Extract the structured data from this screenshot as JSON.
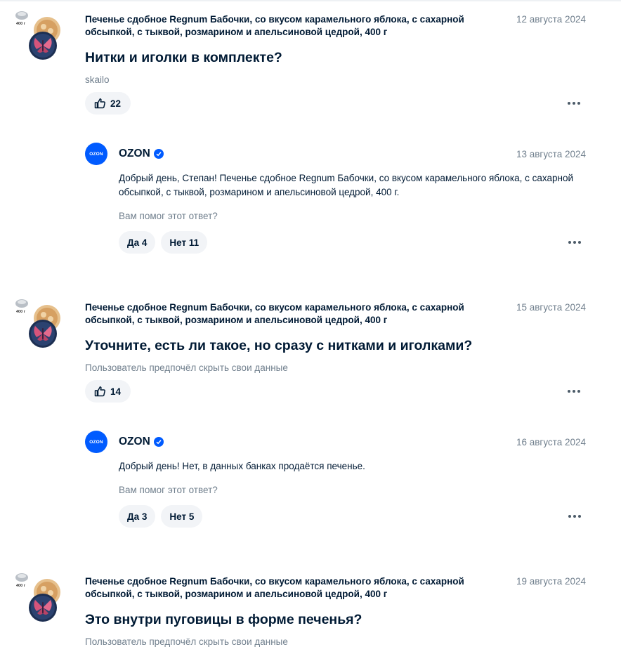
{
  "colors": {
    "accent": "#005bff",
    "text": "#001a34",
    "muted": "#707f8d",
    "chip": "#f2f4f7"
  },
  "questions": [
    {
      "product": "Печенье сдобное Regnum Бабочки, со вкусом карамельного яблока, с сахарной обсыпкой, с тыквой, розмарином и апельсиновой цедрой, 400 г",
      "date": "12 августа 2024",
      "question": "Нитки и иголки в комплекте?",
      "author": "skailo",
      "likes": "22",
      "answer": {
        "logo_text": "OZON",
        "seller": "OZON",
        "date": "13 августа 2024",
        "text": "Добрый день, Степан! Печенье сдобное Regnum Бабочки, со вкусом карамельного яблока, с сахарной обсыпкой, с тыквой, розмарином и апельсиновой цедрой, 400 г.",
        "helpful_prompt": "Вам помог этот ответ?",
        "yes_label": "Да 4",
        "no_label": "Нет 11"
      }
    },
    {
      "product": "Печенье сдобное Regnum Бабочки, со вкусом карамельного яблока, с сахарной обсыпкой, с тыквой, розмарином и апельсиновой цедрой, 400 г",
      "date": "15 августа 2024",
      "question": "Уточните, есть ли такое, но сразу с нитками и иголками?",
      "author": "Пользователь предпочёл скрыть свои данные",
      "likes": "14",
      "answer": {
        "logo_text": "OZON",
        "seller": "OZON",
        "date": "16 августа 2024",
        "text": "Добрый день! Нет, в данных банках продаётся печенье.",
        "helpful_prompt": "Вам помог этот ответ?",
        "yes_label": "Да 3",
        "no_label": "Нет 5"
      }
    },
    {
      "product": "Печенье сдобное Regnum Бабочки, со вкусом карамельного яблока, с сахарной обсыпкой, с тыквой, розмарином и апельсиновой цедрой, 400 г",
      "date": "19 августа 2024",
      "question": "Это внутри пуговицы в форме печенья?",
      "author": "Пользователь предпочёл скрыть свои данные"
    }
  ],
  "thumb_label": "400 г"
}
